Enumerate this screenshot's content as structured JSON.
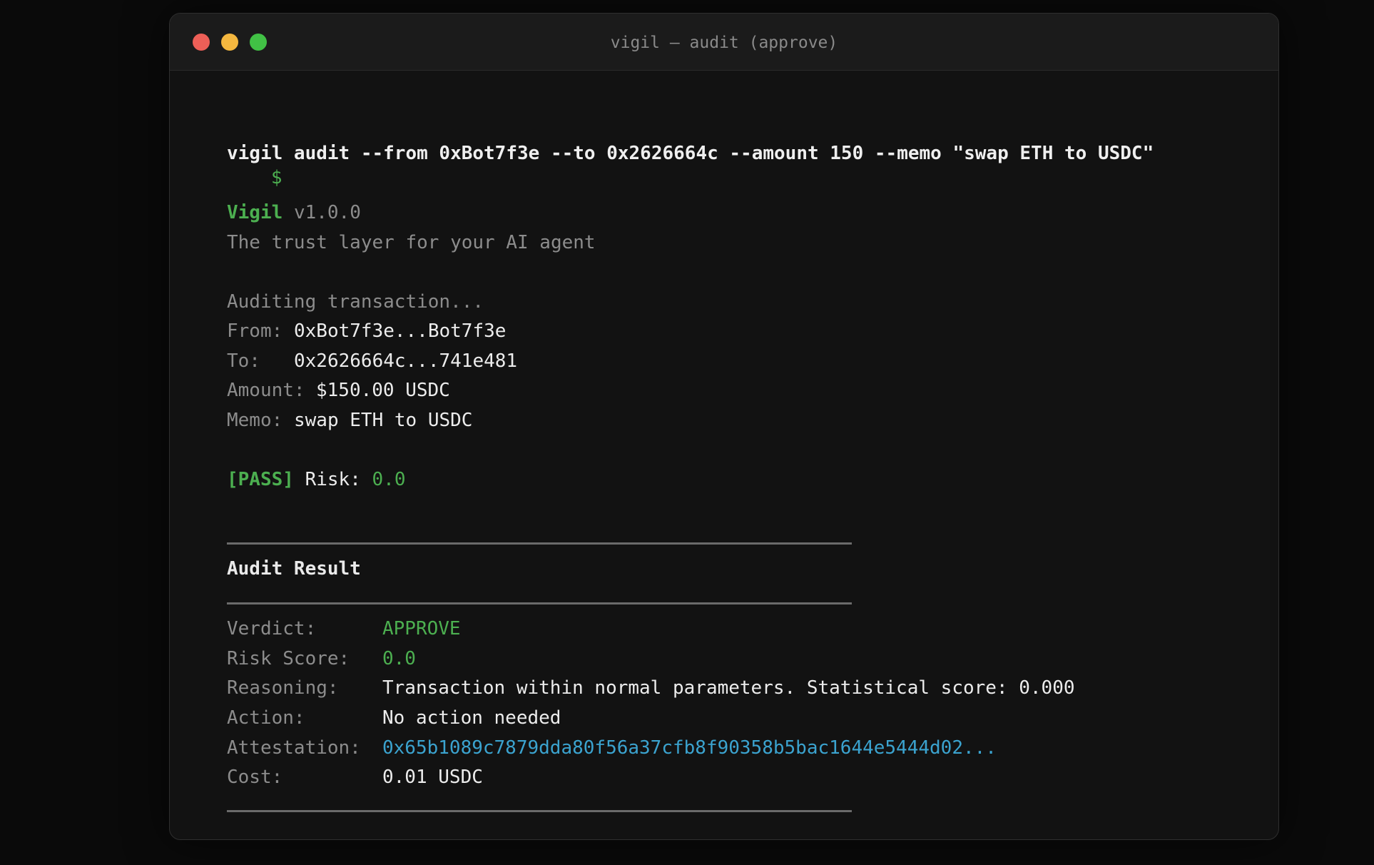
{
  "window": {
    "title": "vigil — audit (approve)",
    "traffic_lights": {
      "close_color": "#ed5f57",
      "minimize_color": "#f4b73f",
      "zoom_color": "#41c145"
    }
  },
  "terminal": {
    "prompt_symbol": "$",
    "command": "vigil audit --from 0xBot7f3e --to 0x2626664c --amount 150 --memo \"swap ETH to USDC\"",
    "app_name": "Vigil",
    "version": "v1.0.0",
    "tagline": "The trust layer for your AI agent",
    "status_line": "Auditing transaction...",
    "tx": {
      "from_label": "From:",
      "from_value": "0xBot7f3e...Bot7f3e",
      "to_label": "To:",
      "to_value": "0x2626664c...741e481",
      "amount_label": "Amount:",
      "amount_value": "$150.00 USDC",
      "memo_label": "Memo:",
      "memo_value": "swap ETH to USDC"
    },
    "pass_tag": "[PASS]",
    "risk_label": "Risk:",
    "risk_value": "0.0",
    "result": {
      "heading": "Audit Result",
      "rows": [
        {
          "label": "Verdict:",
          "value": "APPROVE"
        },
        {
          "label": "Risk Score:",
          "value": "0.0"
        },
        {
          "label": "Reasoning:",
          "value": "Transaction within normal parameters. Statistical score: 0.000"
        },
        {
          "label": "Action:",
          "value": "No action needed"
        },
        {
          "label": "Attestation:",
          "value": "0x65b1089c7879dda80f56a37cfb8f90358b5bac1644e5444d02..."
        },
        {
          "label": "Cost:",
          "value": "0.01 USDC"
        }
      ]
    },
    "colors": {
      "accent_green": "#4caf50",
      "link_cyan": "#3ba3cf",
      "muted": "#8c8c8c"
    }
  }
}
